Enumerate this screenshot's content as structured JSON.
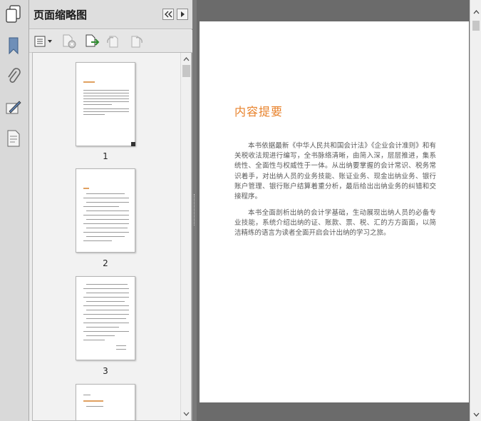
{
  "panel": {
    "title": "页面缩略图"
  },
  "thumbnails": [
    {
      "label": "1",
      "heading": "内容提要"
    },
    {
      "label": "2",
      "heading": "前言"
    },
    {
      "label": "3",
      "heading": ""
    }
  ],
  "page": {
    "title": "内容提要",
    "paragraph1": "本书依据最新《中华人民共和国会计法》《企业会计准则》和有关税收法规进行编写，全书脉络清晰，由简入深，层层推进，集系统性、全面性与权威性于一体。从出纳要掌握的会计常识、税务常识着手，对出纳人员的业务技能、账证业务、现金出纳业务、银行账户管理、银行账户结算着重分析，最后给出出纳业务的纠错和交接程序。",
    "paragraph2": "本书全面剖析出纳的会计学基础，生动展现出纳人员的必备专业技能，系统介绍出纳的证、账款、票、税、汇的方方面面，以简洁精练的语言为读者全面开启会计出纳的学习之旅。"
  },
  "colors": {
    "accent": "#e8822b",
    "panel_bg": "#ececec",
    "workspace_bg": "#6b6b6b"
  },
  "icons": {
    "rail": [
      "pages-icon",
      "bookmark-icon",
      "attachment-icon",
      "signature-icon",
      "layers-icon"
    ],
    "toolbar": [
      "thumbnail-options-icon",
      "delete-pages-icon",
      "insert-pages-icon",
      "rotate-ccw-icon",
      "rotate-cw-icon"
    ]
  }
}
